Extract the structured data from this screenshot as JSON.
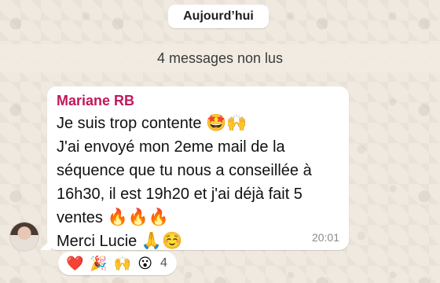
{
  "date_separator": "Aujourd’hui",
  "unread_banner": "4 messages non lus",
  "message": {
    "sender": "Mariane RB",
    "lines": [
      {
        "text": "Je suis trop contente ",
        "emoji": "🤩🙌"
      },
      {
        "text": "J'ai envoyé mon 2eme mail de la",
        "emoji": ""
      },
      {
        "text": "séquence que tu nous a conseillée à",
        "emoji": ""
      },
      {
        "text": "16h30, il est 19h20 et j'ai déjà fait 5",
        "emoji": ""
      },
      {
        "text": "ventes ",
        "emoji": "🔥🔥🔥"
      },
      {
        "text": "Merci Lucie ",
        "emoji": "🙏☺️"
      }
    ],
    "time": "20:01"
  },
  "reactions": {
    "emojis": [
      "❤️",
      "🎉",
      "🙌",
      "😮"
    ],
    "count": "4"
  },
  "colors": {
    "sender_name": "#c2185b",
    "bubble": "#ffffff",
    "background": "#efe9df"
  }
}
